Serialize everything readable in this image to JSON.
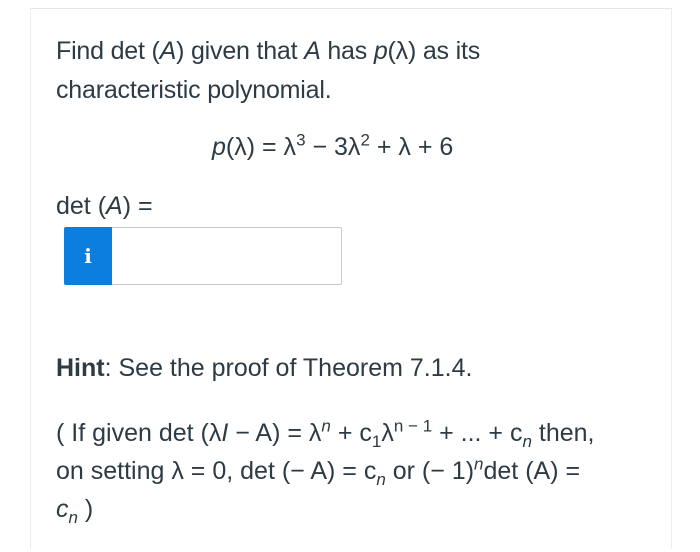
{
  "question": {
    "line1_prefix": "Find det (",
    "line1_A": "A",
    "line1_mid": ") given that ",
    "line1_A2": "A",
    "line1_has": " has ",
    "line1_p": "p",
    "line1_lambda": "(λ)",
    "line1_suffix": " as its",
    "line2": "characteristic polynomial."
  },
  "equation": {
    "lhs_p": "p",
    "lhs_rest": "(λ) = λ",
    "exp3": "3",
    "mid": " − 3λ",
    "exp2": "2",
    "tail": " + λ + 6"
  },
  "answer": {
    "label_prefix": "det (",
    "label_A": "A",
    "label_suffix": ") =",
    "info_icon_glyph": "i",
    "input_value": "",
    "input_placeholder": ""
  },
  "hint": {
    "title": "Hint",
    "text": ": See the proof of Theorem 7.1.4."
  },
  "hint_body": {
    "p1": "( If given det (λ",
    "I": "I",
    "p2": " − A) = λ",
    "n1": "n",
    "p3": " + c",
    "sub1": "1",
    "p4": "λ",
    "exp_n_minus_1": "n − 1",
    "p5": " + ... + c",
    "sub_n": "n",
    "p6": " then,",
    "line2_a": "on setting λ = 0, det (− A) = c",
    "line2_sub_n": "n",
    "line2_b": " or (− 1)",
    "line2_exp_n": "n",
    "line2_c": "det (A) =",
    "line3_c": "c",
    "line3_sub_n": "n",
    "line3_close": " )"
  },
  "colors": {
    "accent": "#0c7fde",
    "text": "#2d3b45",
    "border": "#c8c8c8"
  }
}
